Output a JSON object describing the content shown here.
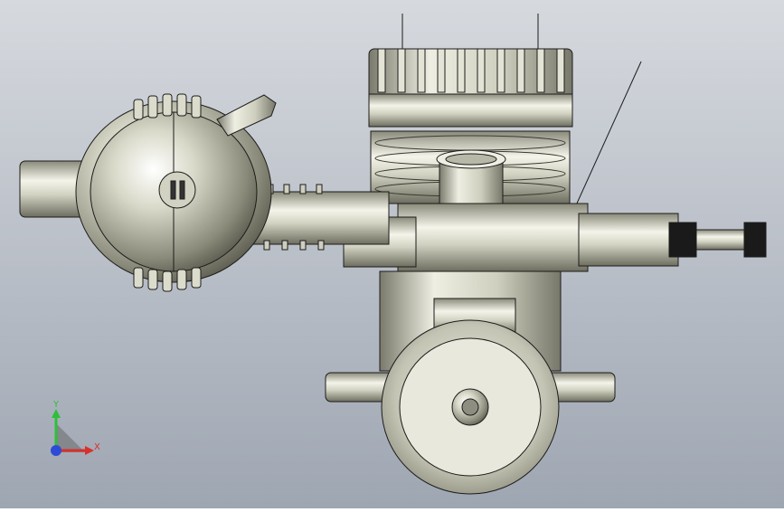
{
  "colors": {
    "bg_top": "#d6d9de",
    "bg_bottom": "#9ea6b2",
    "metal_light": "#f2f2e8",
    "metal_mid": "#c9c9b8",
    "metal_dark": "#7a7a6c",
    "edge": "#1c1c1c",
    "axis_x": "#d9302a",
    "axis_y": "#2fbf3a",
    "axis_z": "#2d4bd6"
  },
  "view": {
    "triad": {
      "x_label": "X",
      "y_label": "Y",
      "x_icon": "x-axis-arrow-icon",
      "y_icon": "y-axis-arrow-icon",
      "z_icon": "z-axis-dot-icon"
    },
    "model_name": "engine-model"
  }
}
